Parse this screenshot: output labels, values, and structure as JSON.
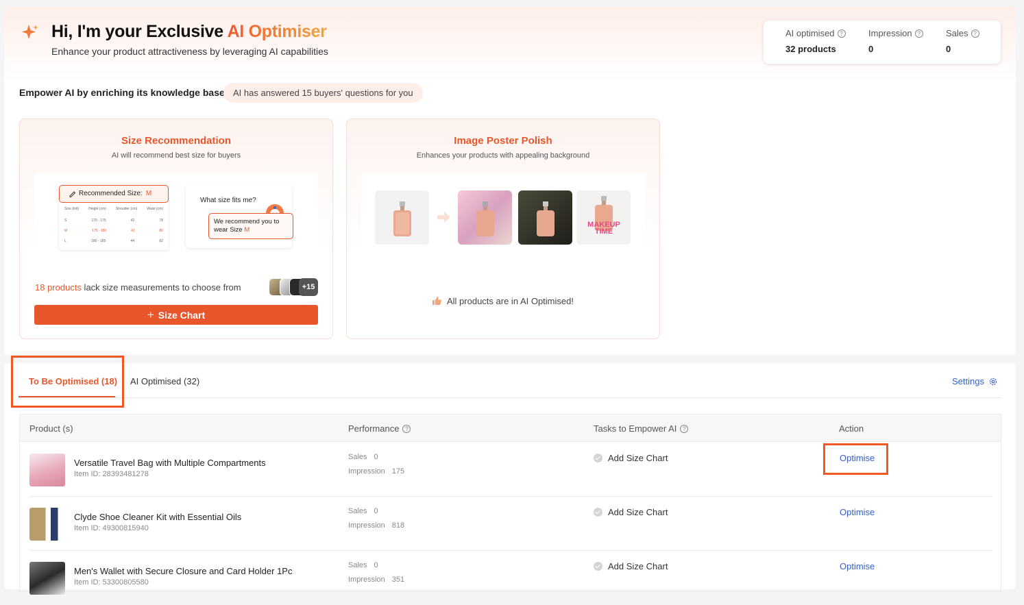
{
  "header": {
    "title_prefix": "Hi, I'm your Exclusive ",
    "title_accent": "AI Optimiser",
    "subtitle": "Enhance your product attractiveness by leveraging AI capabilities"
  },
  "stats": [
    {
      "label": "AI optimised",
      "value": "32 products"
    },
    {
      "label": "Impression",
      "value": "0"
    },
    {
      "label": "Sales",
      "value": "0"
    }
  ],
  "knowledge": {
    "heading": "Empower AI by enriching its knowledge base",
    "badge": "AI has answered 15 buyers' questions for you"
  },
  "size_card": {
    "title": "Size Recommendation",
    "subtitle": "AI will recommend best size for buyers",
    "rec_label": "Recommended Size:",
    "rec_size": "M",
    "table_header": [
      "Size (Intl)",
      "Height (cm)",
      "Shoulder (cm)",
      "Waist (cm)"
    ],
    "table_rows": [
      [
        "S",
        "170 - 175",
        "42",
        "78"
      ],
      [
        "M",
        "175 - 180",
        "43",
        "80"
      ],
      [
        "L",
        "180 - 185",
        "44",
        "82"
      ]
    ],
    "question": "What size fits me?",
    "answer": "We recommend you to wear Size ",
    "answer_size": "M",
    "lack_count": "18 products",
    "lack_text": " lack size measurements to choose from",
    "more_count": "+15",
    "button": "Size Chart",
    "button_icon": "plus-icon"
  },
  "poster_card": {
    "title": "Image Poster Polish",
    "subtitle": "Enhances your products with appealing background",
    "poster_text": "MAKEUP TIME",
    "status": "All products are in AI Optimised!"
  },
  "tabs": {
    "active": "To Be Optimised (18)",
    "other": "AI Optimised (32)",
    "settings": "Settings"
  },
  "table": {
    "headers": {
      "product": "Product (s)",
      "performance": "Performance",
      "tasks": "Tasks to Empower AI",
      "action": "Action"
    },
    "rows": [
      {
        "name": "Versatile Travel Bag with Multiple Compartments",
        "item_id": "Item ID: 28393481278",
        "sales_label": "Sales",
        "sales": "0",
        "imp_label": "Impression",
        "impression": "175",
        "task": "Add Size Chart",
        "action": "Optimise"
      },
      {
        "name": "Clyde Shoe Cleaner Kit with Essential Oils",
        "item_id": "Item ID: 49300815940",
        "sales_label": "Sales",
        "sales": "0",
        "imp_label": "Impression",
        "impression": "818",
        "task": "Add Size Chart",
        "action": "Optimise"
      },
      {
        "name": "Men's Wallet with Secure Closure and Card Holder 1Pc",
        "item_id": "Item ID: 53300805580",
        "sales_label": "Sales",
        "sales": "0",
        "imp_label": "Impression",
        "impression": "351",
        "task": "Add Size Chart",
        "action": "Optimise"
      }
    ]
  },
  "colors": {
    "accent": "#e8562c",
    "link": "#3560c9",
    "highlight": "#f05a22"
  }
}
